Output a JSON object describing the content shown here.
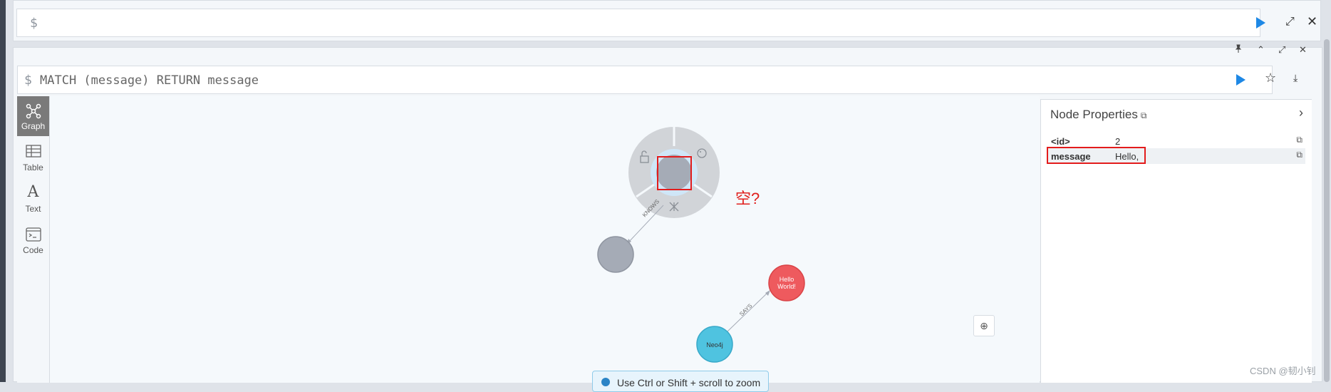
{
  "editor": {
    "prompt": "$"
  },
  "frame": {
    "prompt": "$",
    "query": "MATCH (message) RETURN message"
  },
  "views": [
    {
      "label": "Graph"
    },
    {
      "label": "Table"
    },
    {
      "label": "Text"
    },
    {
      "label": "Code"
    }
  ],
  "graph": {
    "relationship_knows": "KNOWS",
    "relationship_says": "SAYS",
    "node_neo4j": "Neo4j",
    "node_hello_line1": "Hello",
    "node_hello_line2": "World!",
    "annotation": "空?",
    "toast": "Use Ctrl or Shift + scroll to zoom",
    "colors": {
      "neutral_node": "#a5abb6",
      "neo4j_node": "#4fc3e0",
      "hello_node": "#ee5a5e",
      "accent": "#1e88e5",
      "highlight": "#e31c1c"
    }
  },
  "properties": {
    "title": "Node Properties",
    "rows": [
      {
        "key": "<id>",
        "value": "2"
      },
      {
        "key": "message",
        "value": "Hello,"
      }
    ]
  },
  "watermark": "CSDN @韧小钊"
}
